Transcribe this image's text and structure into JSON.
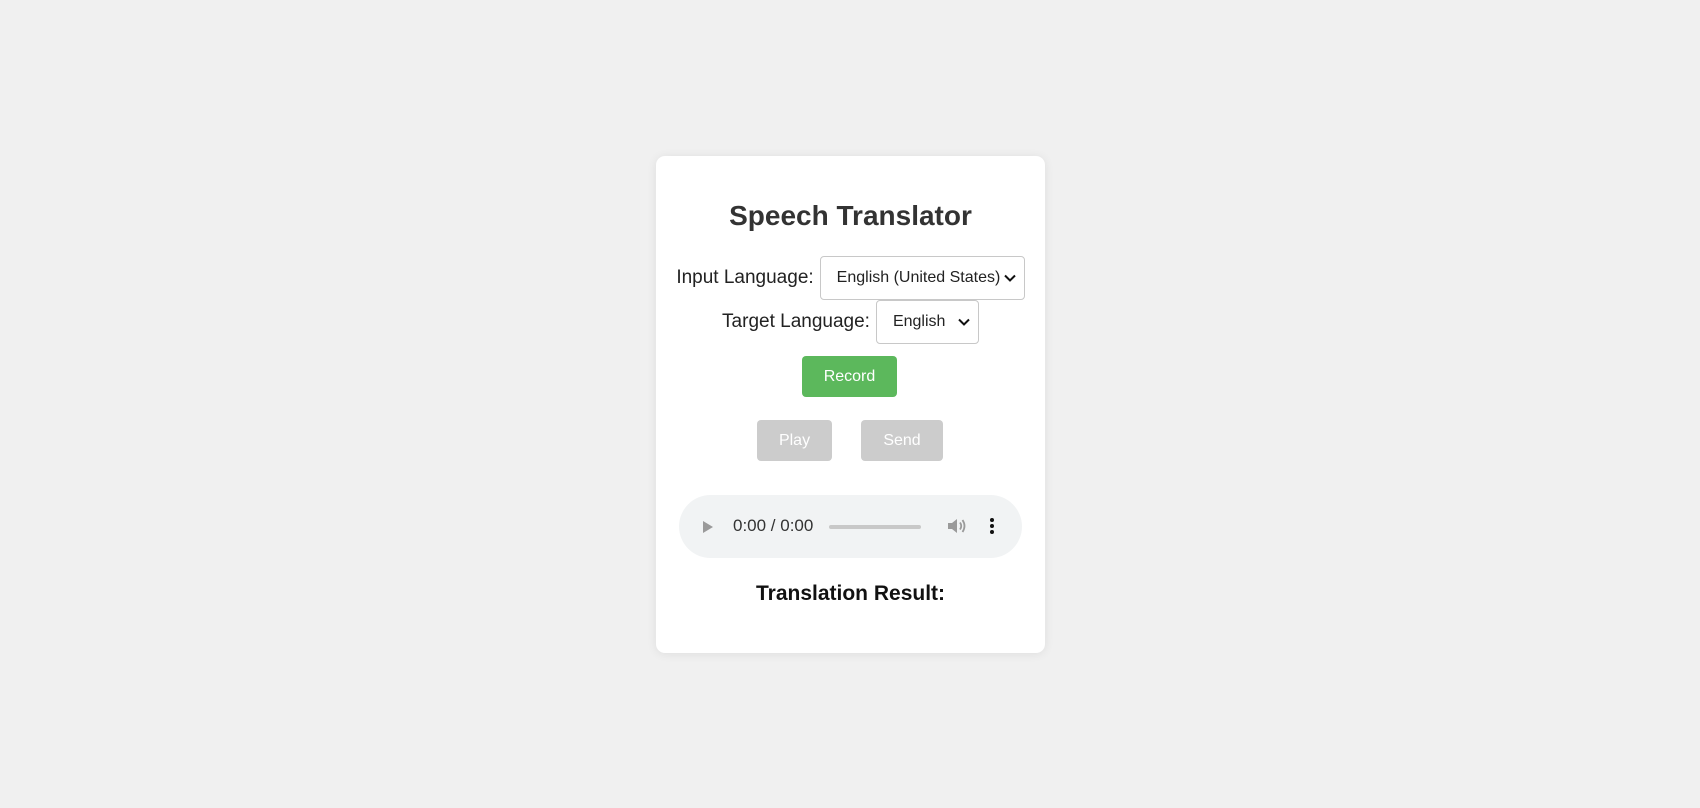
{
  "app": {
    "title": "Speech Translator"
  },
  "input_language": {
    "label": "Input Language:",
    "selected": "English (United States)"
  },
  "target_language": {
    "label": "Target Language:",
    "selected": "English"
  },
  "buttons": {
    "record": "Record",
    "play": "Play",
    "send": "Send"
  },
  "audio_player": {
    "time": "0:00 / 0:00",
    "progress": 0,
    "icons": [
      "play-icon",
      "volume-icon",
      "more-options-icon"
    ]
  },
  "result": {
    "heading": "Translation Result:"
  },
  "colors": {
    "background": "#f0f0f0",
    "card": "#ffffff",
    "record_button": "#5cb85c",
    "disabled_button": "#cccccc",
    "audio_player": "#f1f3f4"
  }
}
